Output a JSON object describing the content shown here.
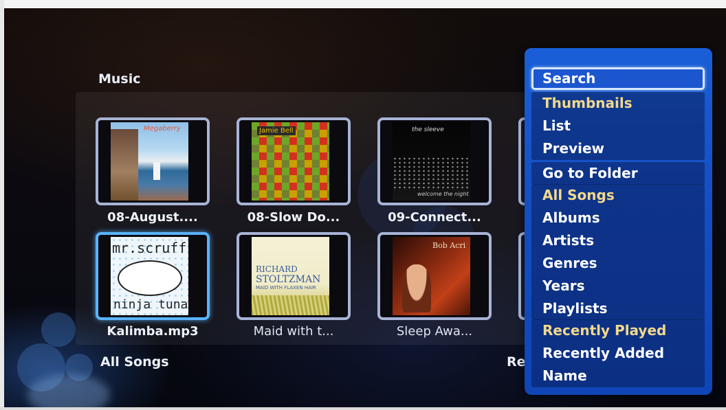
{
  "page": {
    "title": "Music",
    "footer_left": "All Songs",
    "footer_right_partial": "Re"
  },
  "tiles": [
    {
      "caption": "08-August....",
      "art": "lighthouse",
      "art_text": "Megaberry"
    },
    {
      "caption": "08-Slow Do...",
      "art": "checker",
      "art_text": "Jamie Bell"
    },
    {
      "caption": "09-Connect...",
      "art": "nightcity",
      "art_text": "the sleeve",
      "art_text2": "welcome the night"
    },
    {
      "caption": "Kalimba.mp3",
      "art": "scruff",
      "art_text": "mr.scruff",
      "art_text2": "ninja tuna",
      "selected": true
    },
    {
      "caption": "Maid with t...",
      "art": "stoltzman",
      "art_text": "RICHARD",
      "art_text2": "STOLTZMAN",
      "art_text3": "MAID WITH FLAXEN HAIR"
    },
    {
      "caption": "Sleep Awa...",
      "art": "bobacri",
      "art_text": "Bob Acri",
      "art_text2": ""
    }
  ],
  "menu": {
    "groups": [
      {
        "items": [
          {
            "label": "Search",
            "focused": true
          }
        ]
      },
      {
        "items": [
          {
            "label": "Thumbnails",
            "active": true
          },
          {
            "label": "List"
          },
          {
            "label": "Preview"
          }
        ]
      },
      {
        "items": [
          {
            "label": "Go to Folder"
          }
        ]
      },
      {
        "items": [
          {
            "label": "All Songs",
            "active": true
          },
          {
            "label": "Albums"
          },
          {
            "label": "Artists"
          },
          {
            "label": "Genres"
          },
          {
            "label": "Years"
          },
          {
            "label": "Playlists"
          }
        ]
      },
      {
        "items": [
          {
            "label": "Recently Played",
            "active": true
          },
          {
            "label": "Recently Added"
          },
          {
            "label": "Name"
          }
        ]
      }
    ]
  },
  "colors": {
    "menu_bg": "#1450c4",
    "active_item_text": "#f3d98a",
    "selection_glow": "#5ab4ff"
  }
}
